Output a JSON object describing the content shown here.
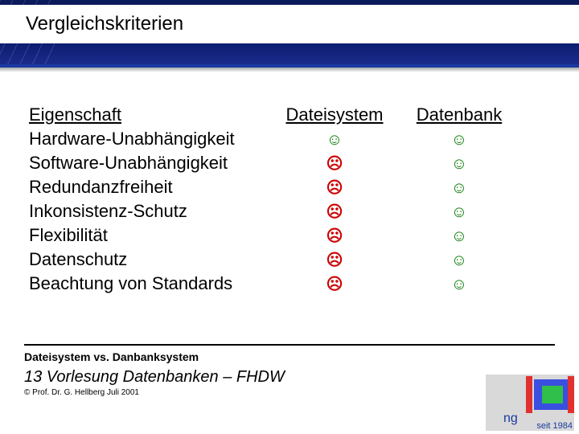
{
  "title": "Vergleichskriterien",
  "table": {
    "headers": {
      "property": "Eigenschaft",
      "filesystem": "Dateisystem",
      "database": "Datenbank"
    },
    "rows": [
      {
        "property": "Hardware-Unabhängigkeit",
        "filesystem": "smile",
        "database": "smile"
      },
      {
        "property": "Software-Unabhängigkeit",
        "filesystem": "frown",
        "database": "smile"
      },
      {
        "property": "Redundanzfreiheit",
        "filesystem": "frown",
        "database": "smile"
      },
      {
        "property": "Inkonsistenz-Schutz",
        "filesystem": "frown",
        "database": "smile"
      },
      {
        "property": "Flexibilität",
        "filesystem": "frown",
        "database": "smile"
      },
      {
        "property": "Datenschutz",
        "filesystem": "frown",
        "database": "smile"
      },
      {
        "property": "Beachtung von Standards",
        "filesystem": "frown",
        "database": "smile"
      }
    ]
  },
  "icons": {
    "smile": "☺",
    "frown": "☹"
  },
  "footer": {
    "section": "Dateisystem vs. Danbanksystem",
    "lecture": "13 Vorlesung Datenbanken – FHDW",
    "copyright": "© Prof. Dr. G. Hellberg Juli 2001",
    "since": "seit 1984",
    "ng": "ng"
  },
  "chart_data": {
    "type": "table",
    "title": "Vergleichskriterien",
    "columns": [
      "Eigenschaft",
      "Dateisystem",
      "Datenbank"
    ],
    "legend": {
      "positive": "☺",
      "negative": "☹"
    },
    "rows": [
      [
        "Hardware-Unabhängigkeit",
        "positive",
        "positive"
      ],
      [
        "Software-Unabhängigkeit",
        "negative",
        "positive"
      ],
      [
        "Redundanzfreiheit",
        "negative",
        "positive"
      ],
      [
        "Inkonsistenz-Schutz",
        "negative",
        "positive"
      ],
      [
        "Flexibilität",
        "negative",
        "positive"
      ],
      [
        "Datenschutz",
        "negative",
        "positive"
      ],
      [
        "Beachtung von Standards",
        "negative",
        "positive"
      ]
    ]
  }
}
